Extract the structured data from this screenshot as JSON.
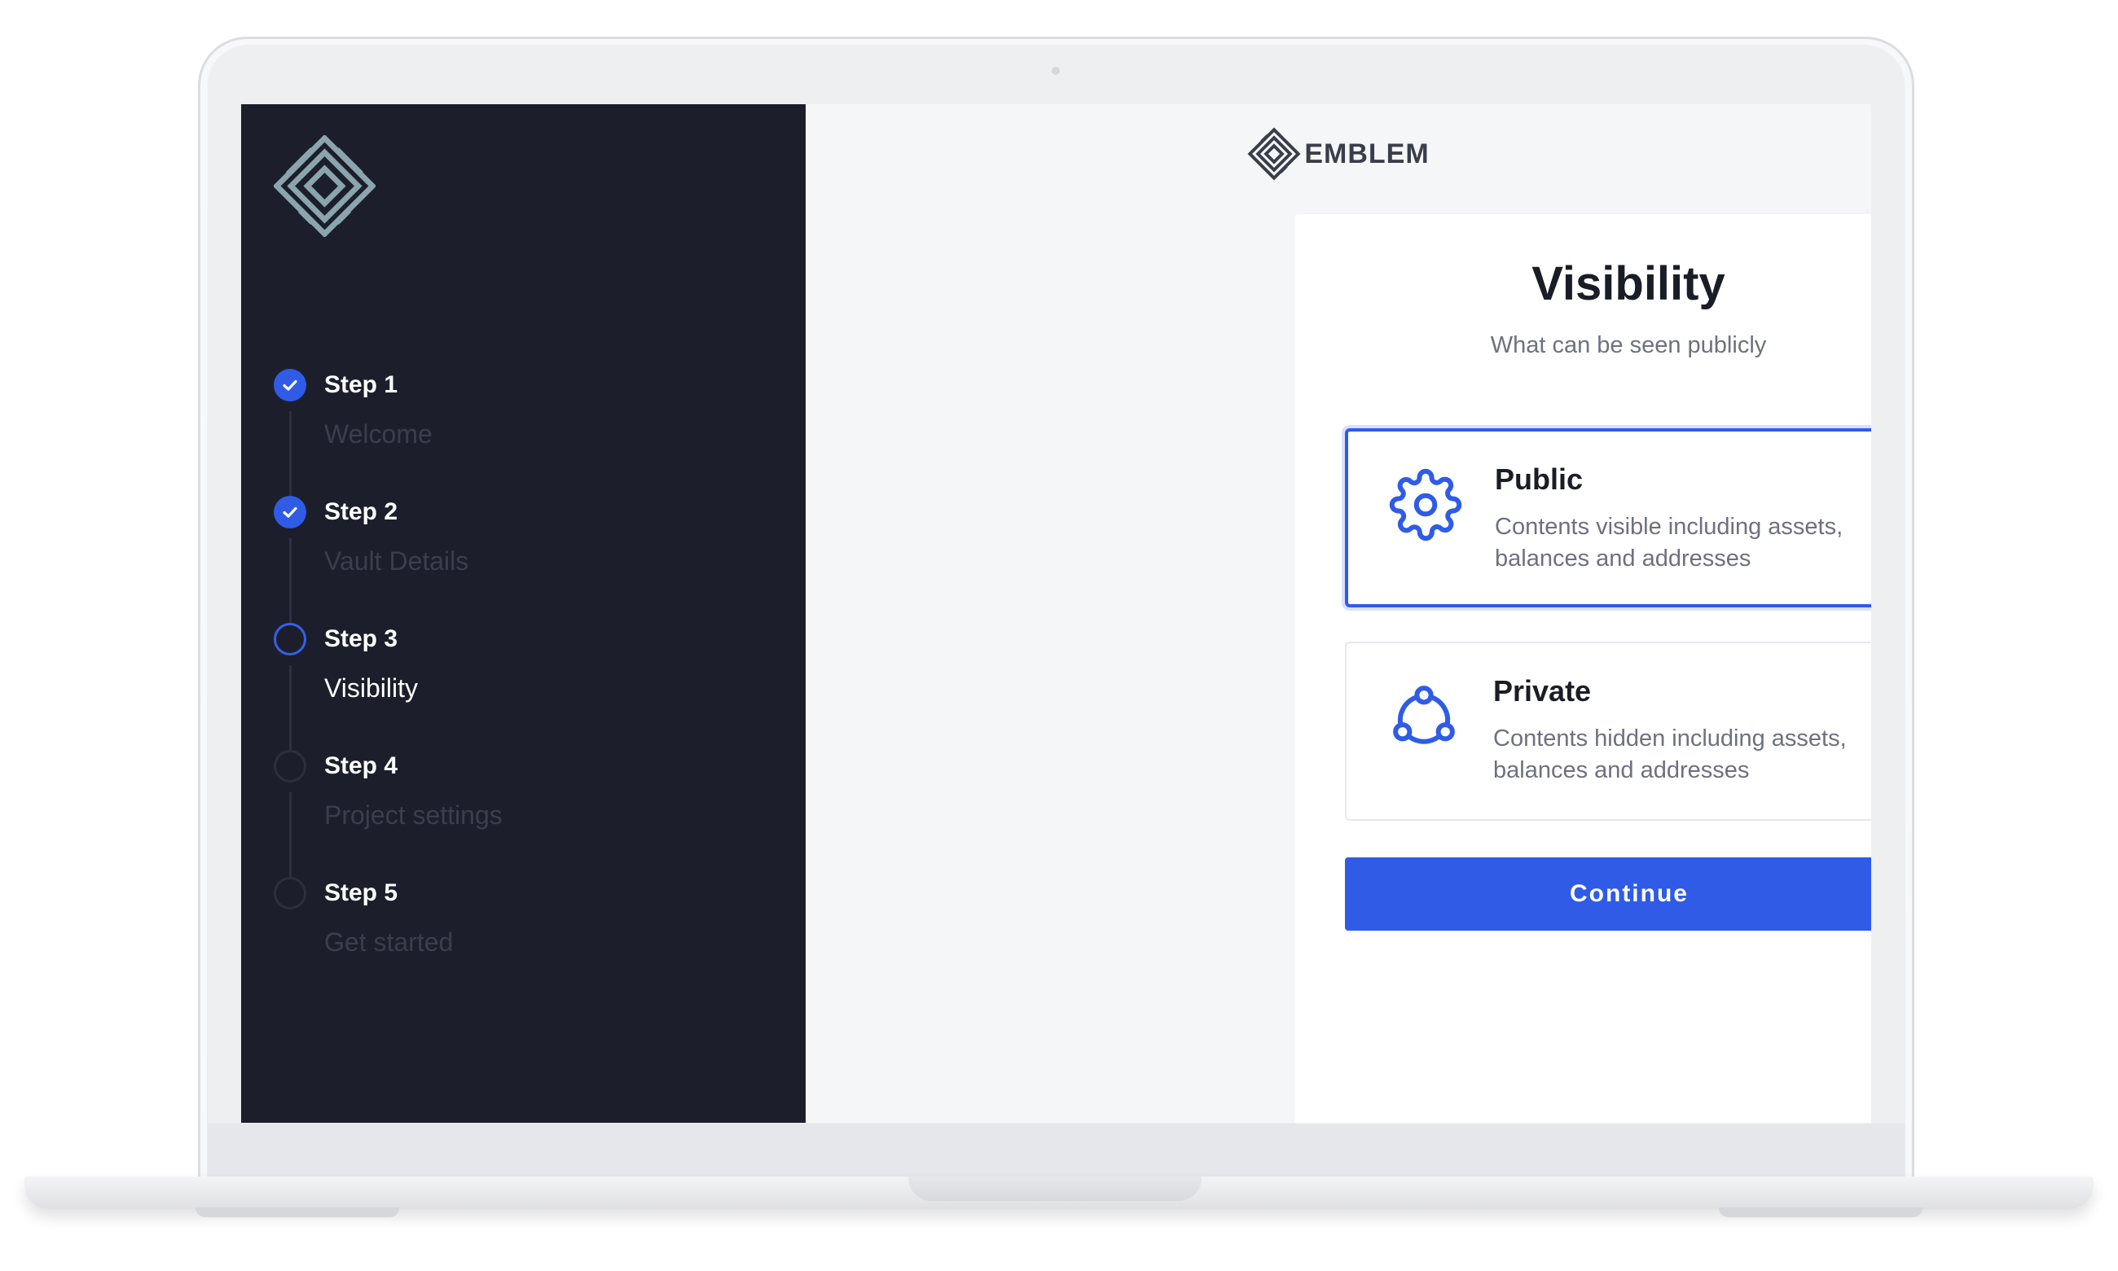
{
  "brand": {
    "name": "EMBLEM",
    "logo_icon": "emblem-logo-icon"
  },
  "sidebar": {
    "steps": [
      {
        "title": "Step 1",
        "subtitle": "Welcome",
        "status": "done"
      },
      {
        "title": "Step 2",
        "subtitle": "Vault Details",
        "status": "done"
      },
      {
        "title": "Step 3",
        "subtitle": "Visibility",
        "status": "current"
      },
      {
        "title": "Step 4",
        "subtitle": "Project settings",
        "status": "todo"
      },
      {
        "title": "Step 5",
        "subtitle": "Get started",
        "status": "todo"
      }
    ]
  },
  "main": {
    "title": "Visibility",
    "subtitle": "What can be seen publicly",
    "options": [
      {
        "title": "Public",
        "description": "Contents visible including assets, balances and addresses",
        "icon": "gear-icon",
        "selected": true
      },
      {
        "title": "Private",
        "description": "Contents hidden including assets, balances and addresses",
        "icon": "network-icon",
        "selected": false
      }
    ],
    "continue_label": "Continue"
  },
  "colors": {
    "sidebar_bg": "#1c1f2b",
    "accent": "#2f5be7",
    "main_bg": "#f5f6f8"
  }
}
